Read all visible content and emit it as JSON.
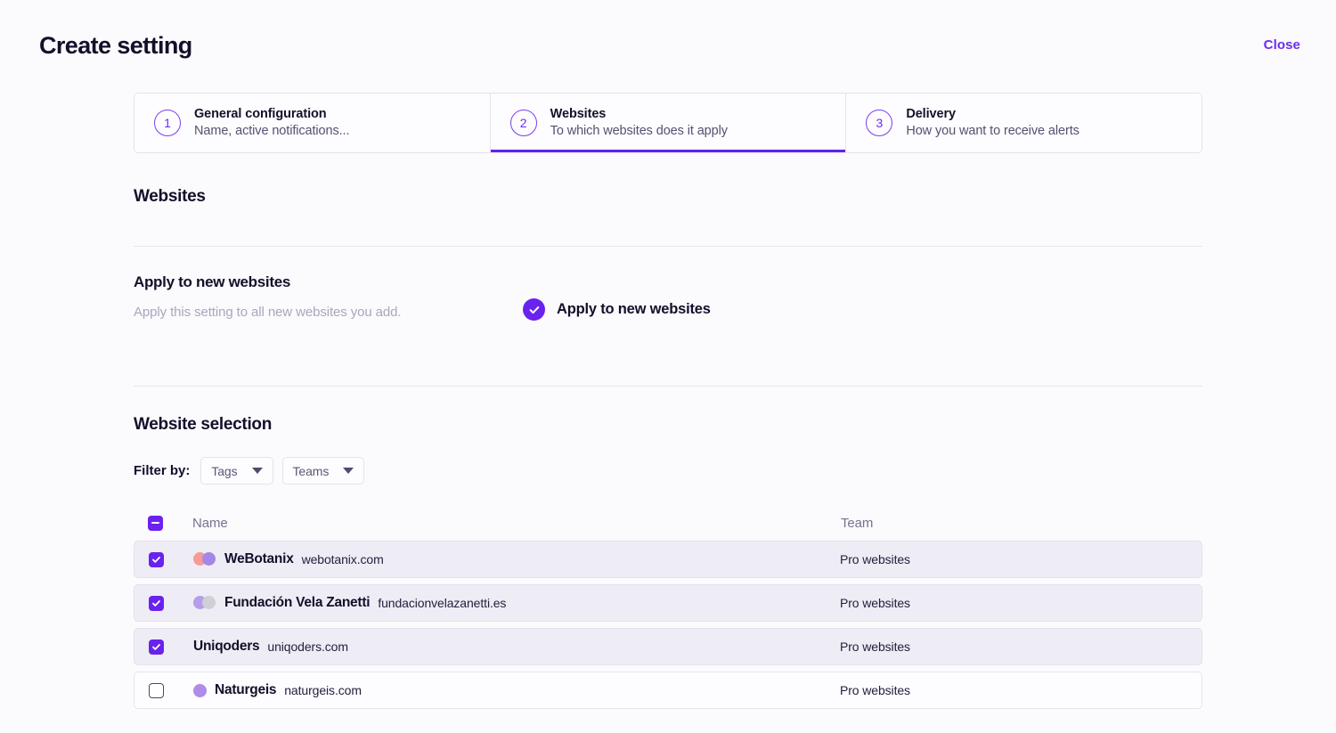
{
  "header": {
    "title": "Create setting",
    "close_label": "Close"
  },
  "stepper": {
    "steps": [
      {
        "number": "1",
        "title": "General configuration",
        "subtitle": "Name, active notifications...",
        "active": false
      },
      {
        "number": "2",
        "title": "Websites",
        "subtitle": "To which websites does it apply",
        "active": true
      },
      {
        "number": "3",
        "title": "Delivery",
        "subtitle": "How you want to receive alerts",
        "active": false
      }
    ]
  },
  "section": {
    "title": "Websites"
  },
  "apply_new": {
    "heading": "Apply to new websites",
    "description": "Apply this setting to all new websites you add.",
    "toggle_label": "Apply to new websites",
    "toggle_checked": true
  },
  "website_selection": {
    "heading": "Website selection",
    "filter_label": "Filter by:",
    "filters": [
      {
        "label": "Tags"
      },
      {
        "label": "Teams"
      }
    ],
    "table": {
      "select_all_state": "indeterminate",
      "columns": {
        "name": "Name",
        "team": "Team"
      },
      "rows": [
        {
          "checked": true,
          "name": "WeBotanix",
          "domain": "webotanix.com",
          "team": "Pro websites",
          "avatar": "double",
          "avatar_back": "#f79a96",
          "avatar_front": "#a585e8"
        },
        {
          "checked": true,
          "name": "Fundación Vela Zanetti",
          "domain": "fundacionvelazanetti.es",
          "team": "Pro websites",
          "avatar": "double",
          "avatar_back": "#b79cec",
          "avatar_front": "#cfcfd6"
        },
        {
          "checked": true,
          "name": "Uniqoders",
          "domain": "uniqoders.com",
          "team": "Pro websites",
          "avatar": "none",
          "avatar_back": "",
          "avatar_front": ""
        },
        {
          "checked": false,
          "name": "Naturgeis",
          "domain": "naturgeis.com",
          "team": "Pro websites",
          "avatar": "single",
          "avatar_back": "",
          "avatar_front": "#b08be8"
        }
      ]
    }
  },
  "colors": {
    "accent": "#6a22ee",
    "accent_link": "#6a2df0",
    "page_background": "#fbfafc",
    "row_selected": "#eeedf5",
    "border": "#e4e3ef"
  }
}
